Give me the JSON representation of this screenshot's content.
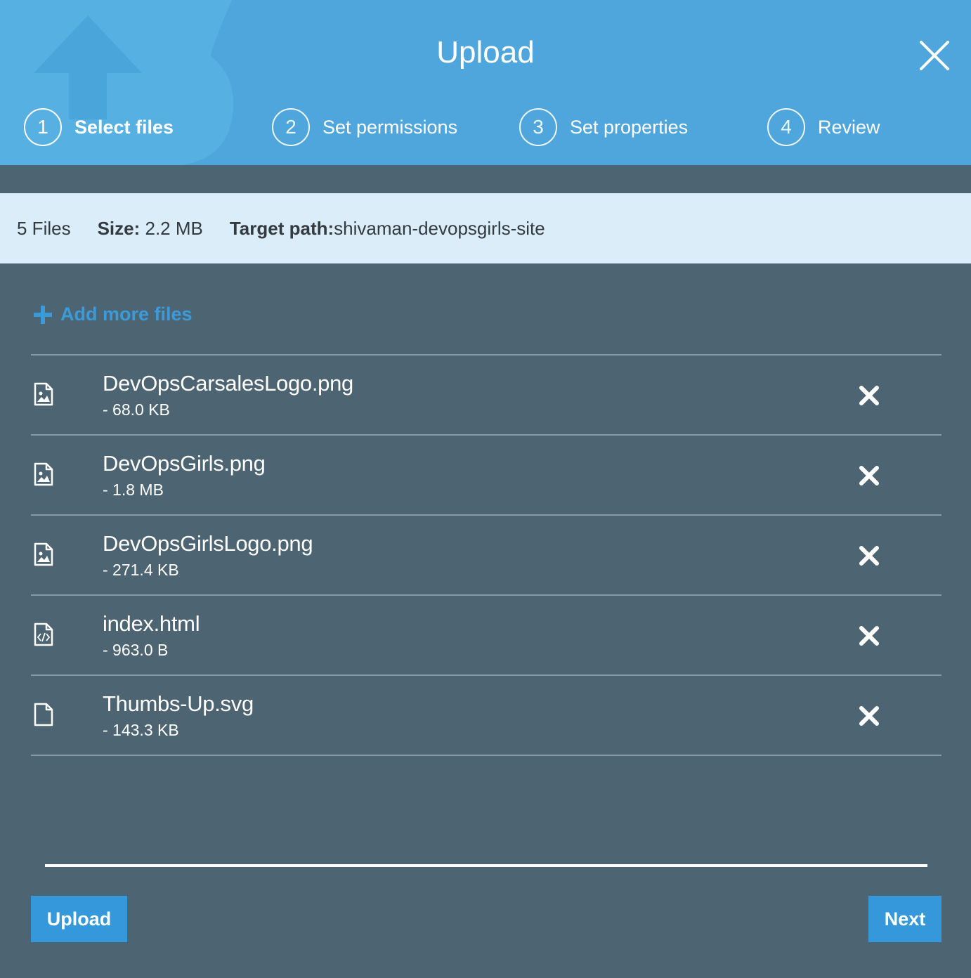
{
  "dialog": {
    "title": "Upload",
    "close_icon": "close-icon"
  },
  "steps": [
    {
      "number": "1",
      "label": "Select files",
      "active": true
    },
    {
      "number": "2",
      "label": "Set permissions",
      "active": false
    },
    {
      "number": "3",
      "label": "Set properties",
      "active": false
    },
    {
      "number": "4",
      "label": "Review",
      "active": false
    }
  ],
  "info": {
    "files_count": "5 Files",
    "size_label": "Size:",
    "size_value": " 2.2 MB",
    "target_label": "Target path:",
    "target_value": "shivaman-devopsgirls-site"
  },
  "add_more": {
    "icon": "plus-icon",
    "label": "Add more files"
  },
  "files": [
    {
      "name": "DevOpsCarsalesLogo.png",
      "size": "- 68.0 KB",
      "icon": "image-file-icon"
    },
    {
      "name": "DevOpsGirls.png",
      "size": "- 1.8 MB",
      "icon": "image-file-icon"
    },
    {
      "name": "DevOpsGirlsLogo.png",
      "size": "- 271.4 KB",
      "icon": "image-file-icon"
    },
    {
      "name": "index.html",
      "size": "- 963.0 B",
      "icon": "code-file-icon"
    },
    {
      "name": "Thumbs-Up.svg",
      "size": "- 143.3 KB",
      "icon": "blank-file-icon"
    }
  ],
  "buttons": {
    "upload": "Upload",
    "next": "Next"
  },
  "colors": {
    "header": "#4ea6dc",
    "body": "#4d6472",
    "info_bar": "#dbedf8",
    "accent": "#3498db"
  }
}
